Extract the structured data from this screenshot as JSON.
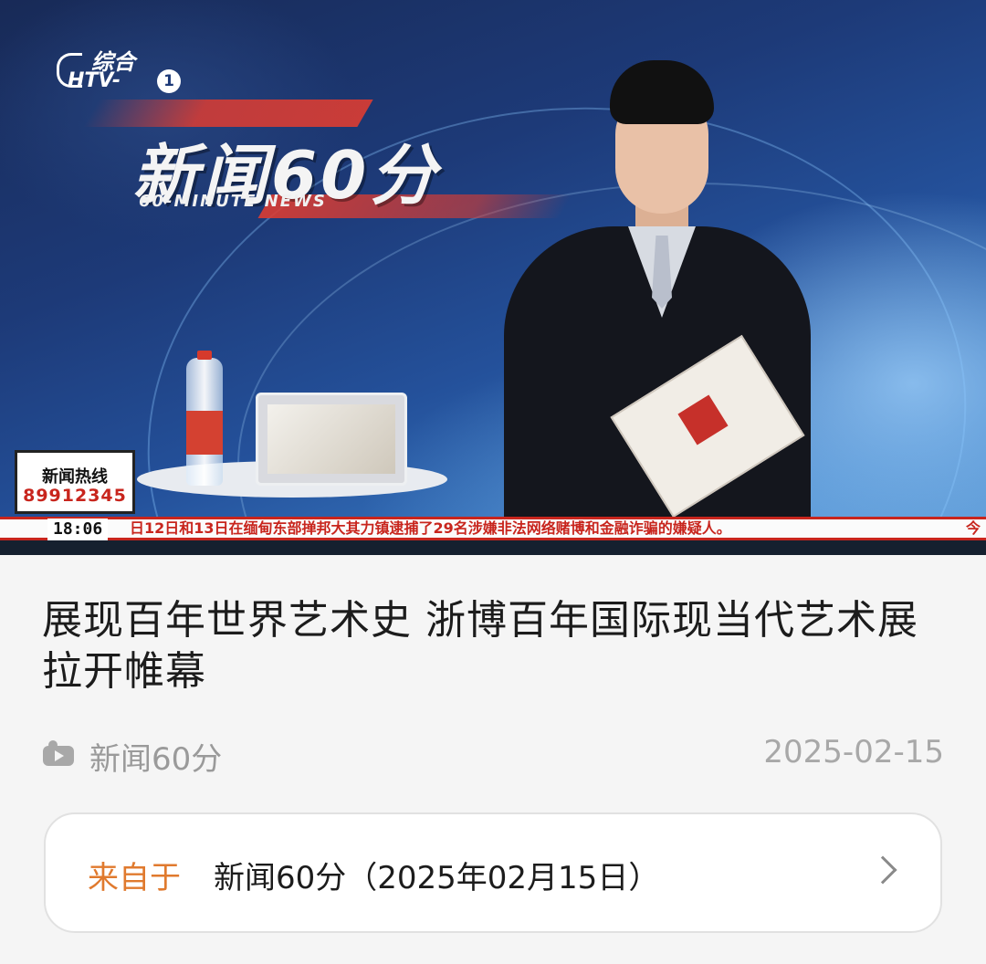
{
  "video": {
    "station_cn": "综合",
    "station_en": "HTV-",
    "station_num": "1",
    "program_title": "新闻60分",
    "program_subtitle": "60-MINUTE NEWS",
    "hotline_label": "新闻热线",
    "hotline_number": "89912345",
    "ticker_time": "18:06",
    "ticker_text": "日12日和13日在缅甸东部掸邦大其力镇逮捕了29名涉嫌非法网络赌博和金融诈骗的嫌疑人。",
    "ticker_next": "今",
    "accent_red": "#c8251d"
  },
  "article": {
    "headline": "展现百年世界艺术史 浙博百年国际现当代艺术展拉开帷幕",
    "source_icon": "video-camera-icon",
    "source_name": "新闻60分",
    "date": "2025-02-15"
  },
  "from_card": {
    "prefix": "来自于",
    "value": "新闻60分（2025年02月15日）",
    "prefix_color": "#e07a2e",
    "chevron_icon": "chevron-right-icon"
  }
}
